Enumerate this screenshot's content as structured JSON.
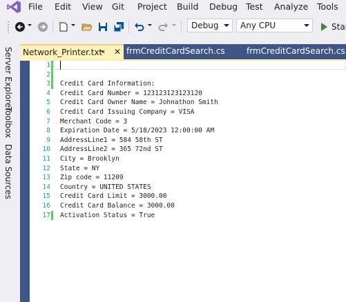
{
  "menubar": {
    "items": [
      "File",
      "Edit",
      "View",
      "Git",
      "Project",
      "Build",
      "Debug",
      "Test",
      "Analyze",
      "Tools"
    ]
  },
  "toolbar": {
    "configuration": "Debug",
    "platform": "Any CPU",
    "start_label": "Star"
  },
  "left_strip": {
    "tabs": [
      "Server Explorer",
      "Toolbox",
      "Data Sources"
    ]
  },
  "tabs": [
    {
      "label": "Network_Printer.txt",
      "active": true
    },
    {
      "label": "frmCreditCardSearch.cs",
      "active": false
    },
    {
      "label": "frmCreditCardSearch.cs [De",
      "active": false
    }
  ],
  "editor": {
    "lines": [
      {
        "num": "1",
        "text": "",
        "changed": true
      },
      {
        "num": "2",
        "text": "",
        "changed": true
      },
      {
        "num": "3",
        "text": "Credit Card Information:",
        "changed": true
      },
      {
        "num": "4",
        "text": "Credit Card Number = 123123123123120",
        "changed": false
      },
      {
        "num": "5",
        "text": "Credit Card Owner Name = Johnathon Smith",
        "changed": false
      },
      {
        "num": "6",
        "text": "Credit Card Issuing Company = VISA",
        "changed": false
      },
      {
        "num": "7",
        "text": "Merchant Code = 3",
        "changed": false
      },
      {
        "num": "8",
        "text": "Expiration Date = 5/18/2023 12:00:00 AM",
        "changed": false
      },
      {
        "num": "9",
        "text": "AddressLine1 = 584 58th ST",
        "changed": false
      },
      {
        "num": "10",
        "text": "AddressLine2 = 365 72nd ST",
        "changed": false
      },
      {
        "num": "11",
        "text": "City = Brooklyn",
        "changed": false
      },
      {
        "num": "12",
        "text": "State = NY",
        "changed": false
      },
      {
        "num": "13",
        "text": "Zip code = 11209",
        "changed": false
      },
      {
        "num": "14",
        "text": "Country = UNITED STATES",
        "changed": false
      },
      {
        "num": "15",
        "text": "Credit Card Limit = 3000.00",
        "changed": false
      },
      {
        "num": "16",
        "text": "Credit Card Balance = 3000.00",
        "changed": false
      },
      {
        "num": "17",
        "text": "Activation Status = True",
        "changed": true
      }
    ]
  },
  "colors": {
    "line_number": "#2b91af",
    "change_marker": "#6cc36c",
    "active_tab": "#fff3b9",
    "dock_background": "#3f5586",
    "vs_logo": "#865fc5"
  },
  "icons": [
    "visual-studio-logo",
    "back-icon",
    "forward-icon",
    "new-item-icon",
    "open-folder-icon",
    "save-icon",
    "save-all-icon",
    "undo-icon",
    "redo-icon",
    "start-play-icon",
    "pin-icon",
    "close-icon"
  ]
}
